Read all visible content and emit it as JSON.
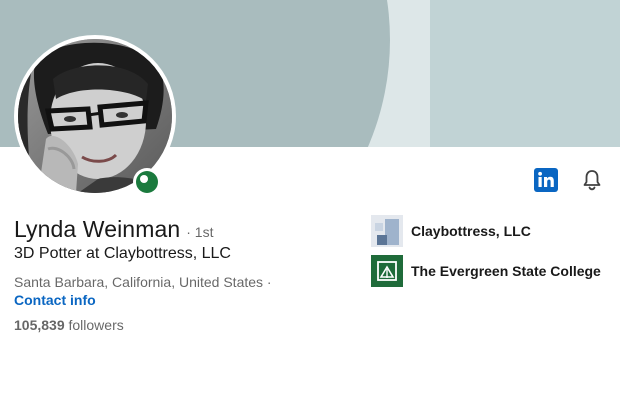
{
  "profile": {
    "name": "Lynda Weinman",
    "degree": "· 1st",
    "headline": "3D Potter at Claybottress, LLC",
    "location": "Santa Barbara, California, United States ·",
    "contact_label": "Contact info",
    "followers_count": "105,839",
    "followers_label": "followers"
  },
  "organizations": [
    {
      "name": "Claybottress, LLC",
      "icon": "claybottress-logo"
    },
    {
      "name": "The Evergreen State College",
      "icon": "evergreen-logo"
    }
  ],
  "icons": {
    "linkedin": "linkedin-icon",
    "bell": "bell-icon",
    "online": "online-status"
  },
  "colors": {
    "banner": "#a9bcbe",
    "link": "#0a66c2",
    "linkedin": "#0a66c2",
    "online": "#1b7a3e"
  }
}
